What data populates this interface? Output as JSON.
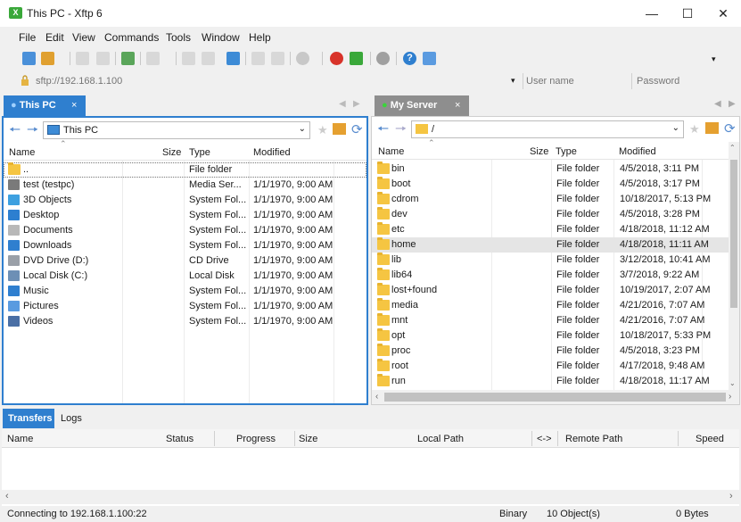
{
  "window": {
    "title": "This PC - Xftp 6",
    "icon_text": "X"
  },
  "menu": [
    "File",
    "Edit",
    "View",
    "Commands",
    "Tools",
    "Window",
    "Help"
  ],
  "address": {
    "host_placeholder": "sftp://192.168.1.100",
    "user_placeholder": "User name",
    "password_placeholder": "Password"
  },
  "left_pane": {
    "tab_label": "This PC",
    "path": "This PC",
    "columns": [
      "Name",
      "Size",
      "Type",
      "Modified"
    ],
    "rows": [
      {
        "name": "..",
        "size": "",
        "type": "File folder",
        "modified": "",
        "icon": "folder-icon"
      },
      {
        "name": "test (testpc)",
        "size": "",
        "type": "Media Ser...",
        "modified": "1/1/1970, 9:00 AM",
        "icon": "media-server-icon"
      },
      {
        "name": "3D Objects",
        "size": "",
        "type": "System Fol...",
        "modified": "1/1/1970, 9:00 AM",
        "icon": "3d-objects-icon"
      },
      {
        "name": "Desktop",
        "size": "",
        "type": "System Fol...",
        "modified": "1/1/1970, 9:00 AM",
        "icon": "desktop-icon"
      },
      {
        "name": "Documents",
        "size": "",
        "type": "System Fol...",
        "modified": "1/1/1970, 9:00 AM",
        "icon": "documents-icon"
      },
      {
        "name": "Downloads",
        "size": "",
        "type": "System Fol...",
        "modified": "1/1/1970, 9:00 AM",
        "icon": "downloads-icon"
      },
      {
        "name": "DVD Drive (D:)",
        "size": "",
        "type": "CD Drive",
        "modified": "1/1/1970, 9:00 AM",
        "icon": "dvd-drive-icon"
      },
      {
        "name": "Local Disk (C:)",
        "size": "",
        "type": "Local Disk",
        "modified": "1/1/1970, 9:00 AM",
        "icon": "local-disk-icon"
      },
      {
        "name": "Music",
        "size": "",
        "type": "System Fol...",
        "modified": "1/1/1970, 9:00 AM",
        "icon": "music-icon"
      },
      {
        "name": "Pictures",
        "size": "",
        "type": "System Fol...",
        "modified": "1/1/1970, 9:00 AM",
        "icon": "pictures-icon"
      },
      {
        "name": "Videos",
        "size": "",
        "type": "System Fol...",
        "modified": "1/1/1970, 9:00 AM",
        "icon": "videos-icon"
      }
    ]
  },
  "right_pane": {
    "tab_label": "My Server",
    "path": "/",
    "columns": [
      "Name",
      "Size",
      "Type",
      "Modified"
    ],
    "rows": [
      {
        "name": "bin",
        "size": "",
        "type": "File folder",
        "modified": "4/5/2018, 3:11 PM"
      },
      {
        "name": "boot",
        "size": "",
        "type": "File folder",
        "modified": "4/5/2018, 3:17 PM"
      },
      {
        "name": "cdrom",
        "size": "",
        "type": "File folder",
        "modified": "10/18/2017, 5:13 PM"
      },
      {
        "name": "dev",
        "size": "",
        "type": "File folder",
        "modified": "4/5/2018, 3:28 PM"
      },
      {
        "name": "etc",
        "size": "",
        "type": "File folder",
        "modified": "4/18/2018, 11:12 AM"
      },
      {
        "name": "home",
        "size": "",
        "type": "File folder",
        "modified": "4/18/2018, 11:11 AM",
        "selected": true
      },
      {
        "name": "lib",
        "size": "",
        "type": "File folder",
        "modified": "3/12/2018, 10:41 AM"
      },
      {
        "name": "lib64",
        "size": "",
        "type": "File folder",
        "modified": "3/7/2018, 9:22 AM"
      },
      {
        "name": "lost+found",
        "size": "",
        "type": "File folder",
        "modified": "10/19/2017, 2:07 AM"
      },
      {
        "name": "media",
        "size": "",
        "type": "File folder",
        "modified": "4/21/2016, 7:07 AM"
      },
      {
        "name": "mnt",
        "size": "",
        "type": "File folder",
        "modified": "4/21/2016, 7:07 AM"
      },
      {
        "name": "opt",
        "size": "",
        "type": "File folder",
        "modified": "10/18/2017, 5:33 PM"
      },
      {
        "name": "proc",
        "size": "",
        "type": "File folder",
        "modified": "4/5/2018, 3:23 PM"
      },
      {
        "name": "root",
        "size": "",
        "type": "File folder",
        "modified": "4/17/2018, 9:48 AM"
      },
      {
        "name": "run",
        "size": "",
        "type": "File folder",
        "modified": "4/18/2018, 11:17 AM"
      }
    ]
  },
  "bottom": {
    "tabs": [
      "Transfers",
      "Logs"
    ],
    "columns": [
      "Name",
      "Status",
      "Progress",
      "Size",
      "Local Path",
      "<->",
      "Remote Path",
      "Speed"
    ]
  },
  "status": {
    "message": "Connecting to 192.168.1.100:22",
    "mode": "Binary",
    "objects": "10 Object(s)",
    "bytes": "0 Bytes"
  },
  "colors": {
    "accent": "#2f7fcf",
    "tab_inactive": "#8e8e8e",
    "folder": "#f5c542",
    "connected_dot": "#3ad43a"
  }
}
